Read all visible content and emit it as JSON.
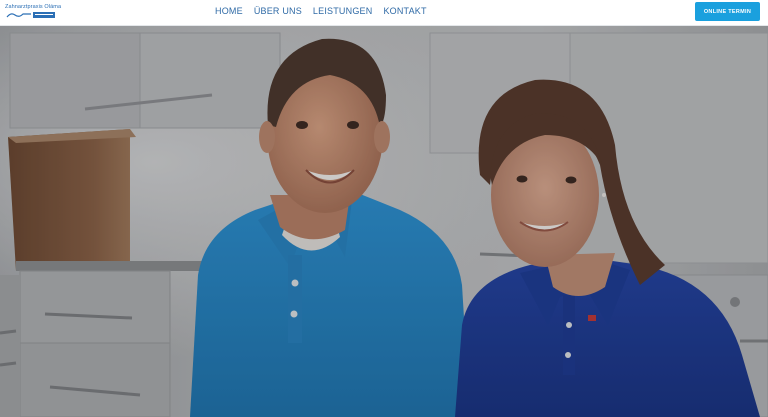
{
  "header": {
    "logo_text": "Zahnarztpraxis Oláma",
    "nav": [
      "HOME",
      "ÜBER UNS",
      "LEISTUNGEN",
      "KONTAKT"
    ],
    "cta_label": "ONLINE TERMIN"
  },
  "colors": {
    "brand_blue": "#2f6aa6",
    "cta_blue": "#1aa0de",
    "shirt_man": "#2b8ccc",
    "shirt_woman": "#1f3f9c"
  },
  "hero": {
    "image": "photo of two smiling dentists in polo shirts in front of white cabinets"
  }
}
